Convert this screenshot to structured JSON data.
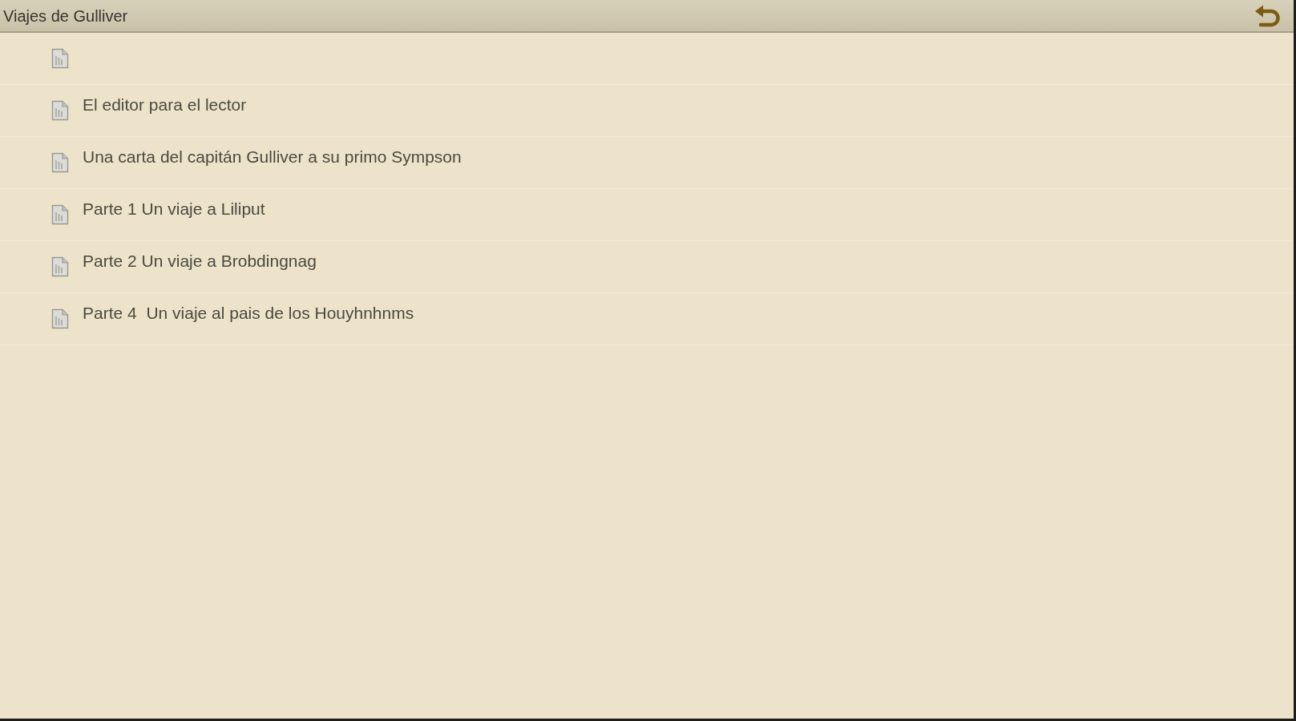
{
  "window": {
    "title": "Viajes de Gulliver"
  },
  "toolbar": {
    "back_button": {
      "kind": "back"
    }
  },
  "chapters": [
    {
      "kind": "untitled"
    },
    {
      "kind": "chapter",
      "title": "El editor para el lector"
    },
    {
      "kind": "chapter",
      "title": "Una carta del capitán Gulliver a su primo Sympson"
    },
    {
      "kind": "chapter",
      "title": "Parte 1 Un viaje a Liliput"
    },
    {
      "kind": "chapter",
      "title": "Parte 2 Un viaje a Brobdingnag"
    },
    {
      "kind": "chapter",
      "title": "Parte 4  Un viaje al pais de los Houyhnhnms"
    }
  ]
}
